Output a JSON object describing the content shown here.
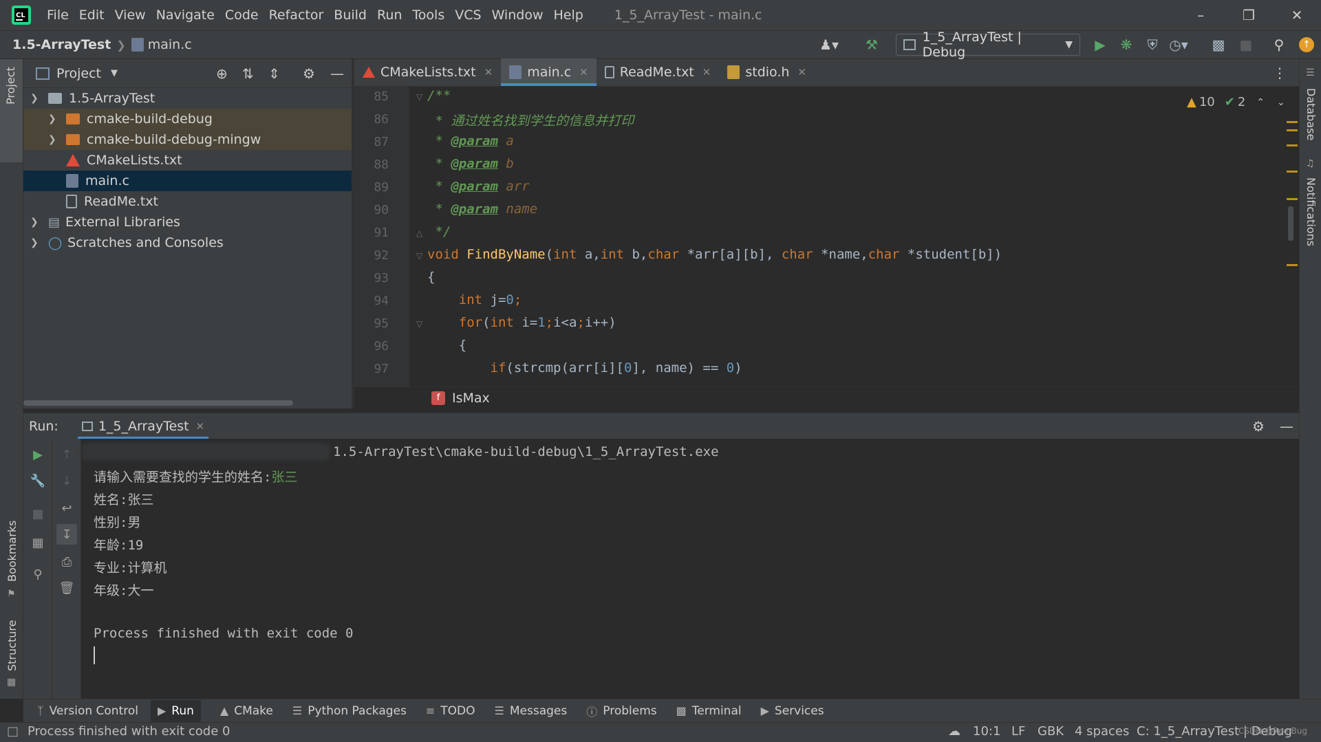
{
  "menubar": {
    "items": [
      "File",
      "Edit",
      "View",
      "Navigate",
      "Code",
      "Refactor",
      "Build",
      "Run",
      "Tools",
      "VCS",
      "Window",
      "Help"
    ],
    "title": "1_5_ArrayTest - main.c"
  },
  "navbar": {
    "project": "1.5-ArrayTest",
    "file": "main.c",
    "run_config": "1_5_ArrayTest | Debug"
  },
  "project_panel": {
    "title": "Project",
    "tree": [
      {
        "label": "1.5-ArrayTest",
        "type": "root"
      },
      {
        "label": "cmake-build-debug",
        "type": "folder"
      },
      {
        "label": "cmake-build-debug-mingw",
        "type": "folder"
      },
      {
        "label": "CMakeLists.txt",
        "type": "cmake"
      },
      {
        "label": "main.c",
        "type": "c",
        "selected": true
      },
      {
        "label": "ReadMe.txt",
        "type": "txt"
      },
      {
        "label": "External Libraries",
        "type": "lib"
      },
      {
        "label": "Scratches and Consoles",
        "type": "scratch"
      }
    ]
  },
  "tabs": [
    {
      "label": "CMakeLists.txt"
    },
    {
      "label": "main.c",
      "active": true
    },
    {
      "label": "ReadMe.txt"
    },
    {
      "label": "stdio.h"
    }
  ],
  "editor": {
    "warnings": "10",
    "ok": "2",
    "line_numbers": [
      "85",
      "86",
      "87",
      "88",
      "89",
      "90",
      "91",
      "92",
      "93",
      "94",
      "95",
      "96",
      "97"
    ],
    "comment_line": "通过姓名找到学生的信息并打印",
    "param_tag": "@param",
    "params": [
      "a",
      "b",
      "arr",
      "name"
    ],
    "breadcrumb": "IsMax"
  },
  "run_panel": {
    "label": "Run:",
    "tab": "1_5_ArrayTest",
    "path": "1.5-ArrayTest\\cmake-build-debug\\1_5_ArrayTest.exe",
    "prompt": "请输入需要查找的学生的姓名:",
    "input": "张三",
    "output": [
      "姓名:张三",
      "性别:男",
      "年龄:19",
      "专业:计算机",
      "年级:大一"
    ],
    "exit": "Process finished with exit code 0"
  },
  "side_labels": {
    "project": "Project",
    "bookmarks": "Bookmarks",
    "structure": "Structure",
    "database": "Database",
    "notifications": "Notifications"
  },
  "bottom_tabs": [
    "Version Control",
    "Run",
    "CMake",
    "Python Packages",
    "TODO",
    "Messages",
    "Problems",
    "Terminal",
    "Services"
  ],
  "status": {
    "message": "Process finished with exit code 0",
    "position": "10:1",
    "line_sep": "LF",
    "encoding": "GBK",
    "indent": "4 spaces",
    "context": "C: 1_5_ArrayTest | Debug",
    "watermark": "CSDN @Ree-Bug"
  },
  "colors": {
    "accent": "#4a88c7",
    "keyword": "#cc7832",
    "number": "#6897bb",
    "function": "#ffc66d",
    "comment": "#629755",
    "selection": "#0d293e"
  }
}
